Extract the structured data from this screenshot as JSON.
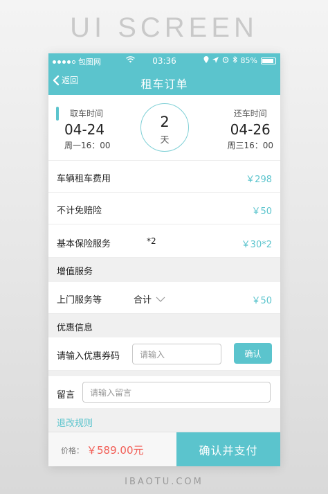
{
  "page": {
    "header": "UI SCREEN",
    "footer": "IBAOTU.COM"
  },
  "status_bar": {
    "carrier": "包图网",
    "time": "03:36",
    "battery": "85%",
    "icons": [
      "signal-dots-icon",
      "wifi-icon",
      "location-icon",
      "alarm-icon",
      "bluetooth-icon",
      "battery-icon"
    ]
  },
  "nav": {
    "back_label": "返回",
    "title": "租车订单"
  },
  "rental_period": {
    "pickup": {
      "label": "取车时间",
      "date": "04-24",
      "weekday": "周一16：00"
    },
    "return": {
      "label": "还车时间",
      "date": "04-26",
      "weekday": "周三16：00"
    },
    "days": "2",
    "days_unit": "天"
  },
  "fees": {
    "rental": {
      "label": "车辆租车费用",
      "amount": "￥298"
    },
    "waiver": {
      "label": "不计免赔险",
      "amount": "￥50"
    },
    "insurance": {
      "label": "基本保险服务",
      "qty": "*2",
      "amount": "￥30*2"
    }
  },
  "value_added": {
    "section_title": "增值服务",
    "item_label": "上门服务等",
    "total_label": "合计",
    "amount": "￥50"
  },
  "discount": {
    "section_title": "优惠信息",
    "coupon_label": "请输入优惠券码",
    "coupon_placeholder": "请输入",
    "confirm_label": "确认"
  },
  "message": {
    "label": "留言",
    "placeholder": "请输入留言"
  },
  "policy_link": "退改规则",
  "checkout": {
    "price_label": "价格：",
    "price_value": "￥589.00元",
    "pay_label": "确认并支付"
  },
  "colors": {
    "accent": "#5bc4cd",
    "price": "#f25c54",
    "section_bg": "#f0f0f0"
  }
}
